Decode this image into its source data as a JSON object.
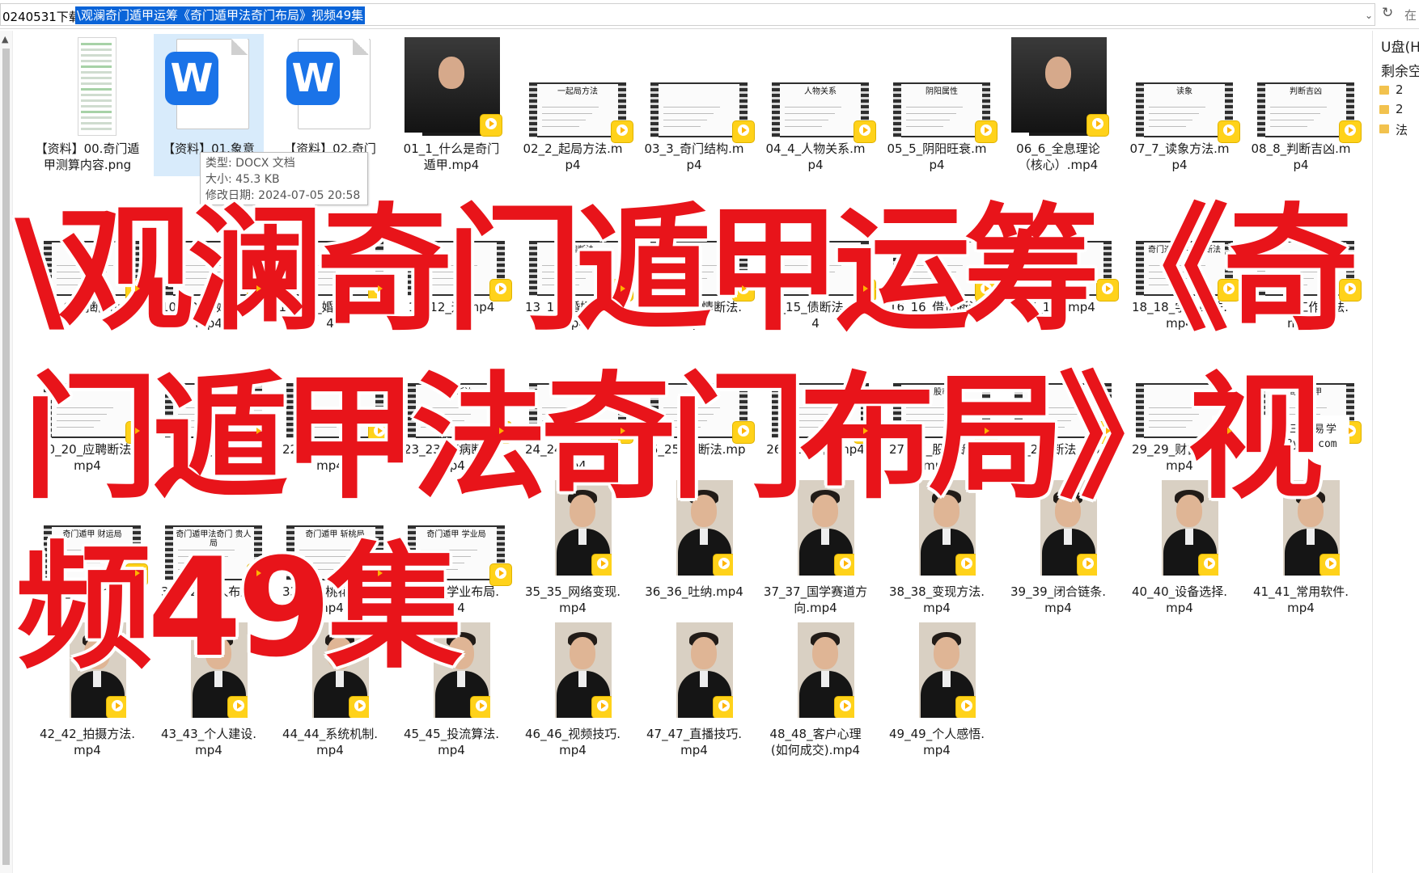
{
  "address_bar": {
    "path_prefix": "0240531下载",
    "path_selected": "\\观澜奇门遁甲运筹《奇门遁甲法奇门布局》视频49集",
    "dropdown_icon": "chevron-down-icon",
    "refresh_icon": "refresh-icon",
    "search_stub": "在"
  },
  "right_panel": {
    "drive": "U盘(H",
    "free": "剩余空",
    "rows": [
      "2",
      "2",
      "法"
    ]
  },
  "tooltip": {
    "type": "类型: DOCX 文档",
    "size": "大小: 45.3 KB",
    "modified": "修改日期: 2024-07-05 20:58"
  },
  "overlay": {
    "line1": "\\观澜奇门遁甲运筹《奇",
    "line2": "门遁甲法奇门布局》视",
    "line3": "频49集"
  },
  "watermark": {
    "line1": "三易易学",
    "line2": "3yyx.com"
  },
  "files": [
    {
      "name": "【资料】00.奇门遁甲测算内容.png",
      "kind": "png"
    },
    {
      "name": "【资料】01.象意",
      "kind": "docx",
      "selected": true
    },
    {
      "name": "【资料】02.奇门",
      "kind": "docx"
    },
    {
      "name": "01_1_什么是奇门遁甲.mp4",
      "kind": "video"
    },
    {
      "name": "02_2_起局方法.mp4",
      "kind": "film",
      "slide": "一起局方法"
    },
    {
      "name": "03_3_奇门结构.mp4",
      "kind": "film",
      "slide": ""
    },
    {
      "name": "04_4_人物关系.mp4",
      "kind": "film",
      "slide": "人物关系"
    },
    {
      "name": "05_5_阴阳旺衰.mp4",
      "kind": "film",
      "slide": "阴阳属性"
    },
    {
      "name": "06_6_全息理论（核心）.mp4",
      "kind": "video"
    },
    {
      "name": "07_7_读象方法.mp4",
      "kind": "film",
      "slide": "读象"
    },
    {
      "name": "08_8_判断吉凶.mp4",
      "kind": "film",
      "slide": "判断吉凶"
    },
    {
      "name": "09_9_判断.mp4",
      "kind": "film",
      "slide": ""
    },
    {
      "name": "10_10_婚姻断法.mp4",
      "kind": "film",
      "slide": ""
    },
    {
      "name": "11_11_婚姻局.mp4",
      "kind": "film",
      "slide": ""
    },
    {
      "name": "12_12_运.mp4",
      "kind": "film",
      "slide": ""
    },
    {
      "name": "13_13_婚姻方法.mp4",
      "kind": "film",
      "slide": "婚姻断法"
    },
    {
      "name": "14_14_感情断法.mp4",
      "kind": "film",
      "slide": ""
    },
    {
      "name": "15_15_债断法.mp4",
      "kind": "film",
      "slide": "过债"
    },
    {
      "name": "16_16_借贷断法.mp4",
      "kind": "film",
      "slide": "借贷"
    },
    {
      "name": "17_17_.mp4",
      "kind": "film",
      "slide": ""
    },
    {
      "name": "18_18_学业断法.mp4",
      "kind": "film",
      "slide": "奇门遁甲学业局断法"
    },
    {
      "name": "19_19_工作断法.mp4",
      "kind": "film",
      "slide": ""
    },
    {
      "name": "20_20_应聘断法.mp4",
      "kind": "film",
      "slide": ""
    },
    {
      "name": "21_21_.mp4",
      "kind": "film",
      "slide": ""
    },
    {
      "name": "22_22_寻物断法.mp4",
      "kind": "film",
      "slide": ""
    },
    {
      "name": "23_23_疾病断法.mp4",
      "kind": "film",
      "slide": "疾病断法"
    },
    {
      "name": "24_24_测孕断法.mp4",
      "kind": "film",
      "slide": "测孕断法"
    },
    {
      "name": "25_25_判断法.mp4",
      "kind": "film",
      "slide": ""
    },
    {
      "name": "26_26_合作.mp4",
      "kind": "film",
      "slide": "作局"
    },
    {
      "name": "27_27_股市断法.mp4",
      "kind": "film",
      "slide": "股市"
    },
    {
      "name": "28_28_断法.mp4",
      "kind": "film",
      "slide": ""
    },
    {
      "name": "29_29_财富布局.mp4",
      "kind": "film",
      "slide": ""
    },
    {
      "name": "30_30_.mp4",
      "kind": "film",
      "slide": "奇门遁甲"
    },
    {
      "name": "31_31_.mp4",
      "kind": "film",
      "slide": "奇门遁甲 财运局"
    },
    {
      "name": "32_32_贵人布局.mp4",
      "kind": "film",
      "slide": "奇门遁甲法奇门 贵人局"
    },
    {
      "name": "33_33_桃花布局.mp4",
      "kind": "film",
      "slide": "奇门遁甲 斩桃局"
    },
    {
      "name": "34_34_学业布局.mp4",
      "kind": "film",
      "slide": "奇门遁甲 学业局"
    },
    {
      "name": "35_35_网络变现.mp4",
      "kind": "portrait"
    },
    {
      "name": "36_36_吐纳.mp4",
      "kind": "portrait"
    },
    {
      "name": "37_37_国学赛道方向.mp4",
      "kind": "portrait"
    },
    {
      "name": "38_38_变现方法.mp4",
      "kind": "portrait"
    },
    {
      "name": "39_39_闭合链条.mp4",
      "kind": "portrait"
    },
    {
      "name": "40_40_设备选择.mp4",
      "kind": "portrait"
    },
    {
      "name": "41_41_常用软件.mp4",
      "kind": "portrait"
    },
    {
      "name": "42_42_拍摄方法.mp4",
      "kind": "portrait"
    },
    {
      "name": "43_43_个人建设.mp4",
      "kind": "portrait"
    },
    {
      "name": "44_44_系统机制.mp4",
      "kind": "portrait"
    },
    {
      "name": "45_45_投流算法.mp4",
      "kind": "portrait"
    },
    {
      "name": "46_46_视频技巧.mp4",
      "kind": "portrait"
    },
    {
      "name": "47_47_直播技巧.mp4",
      "kind": "portrait"
    },
    {
      "name": "48_48_客户心理(如何成交).mp4",
      "kind": "portrait"
    },
    {
      "name": "49_49_个人感悟.mp4",
      "kind": "portrait"
    }
  ]
}
